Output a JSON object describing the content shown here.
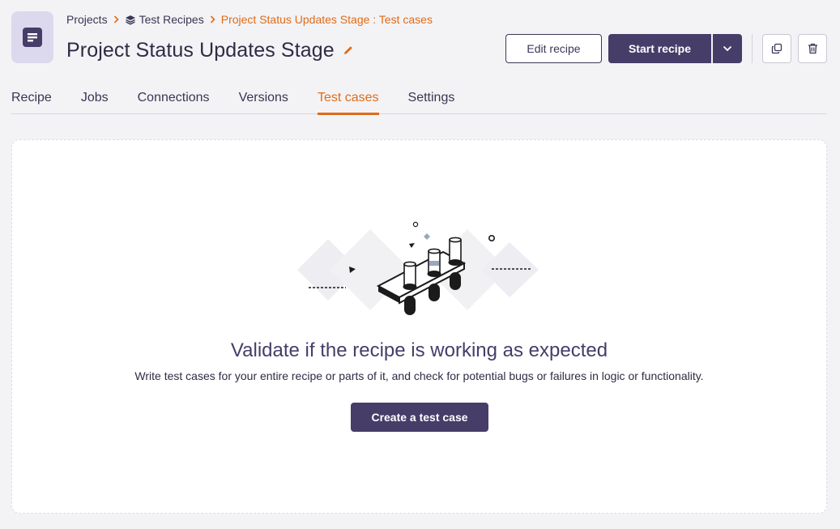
{
  "breadcrumb": {
    "projects": "Projects",
    "folder": "Test Recipes",
    "current": "Project Status Updates Stage : Test cases"
  },
  "header": {
    "title": "Project Status Updates Stage",
    "edit_recipe_label": "Edit recipe",
    "start_recipe_label": "Start recipe"
  },
  "tabs": [
    {
      "label": "Recipe",
      "active": false
    },
    {
      "label": "Jobs",
      "active": false
    },
    {
      "label": "Connections",
      "active": false
    },
    {
      "label": "Versions",
      "active": false
    },
    {
      "label": "Test cases",
      "active": true
    },
    {
      "label": "Settings",
      "active": false
    }
  ],
  "empty_state": {
    "title": "Validate if the recipe is working as expected",
    "description": "Write test cases for your entire recipe or parts of it, and check for potential bugs or failures in logic or functionality.",
    "button_label": "Create a test case"
  },
  "icons": {
    "recipe": "document-icon",
    "folder": "stack-icon",
    "edit": "pencil-icon",
    "dropdown": "chevron-down-icon",
    "duplicate": "copy-icon",
    "delete": "trash-icon"
  },
  "colors": {
    "accent": "#e06b16",
    "primary": "#463d69",
    "background": "#f3f3f6"
  }
}
